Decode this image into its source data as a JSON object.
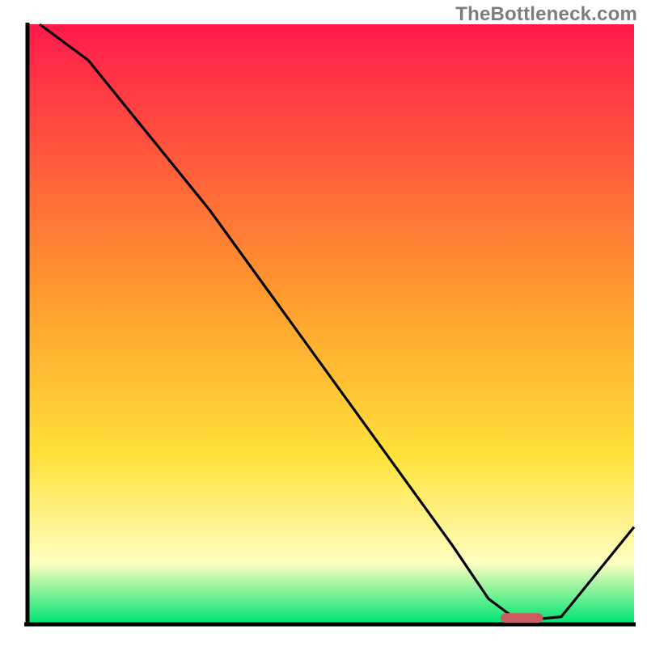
{
  "watermark": "TheBottleneck.com",
  "colors": {
    "gradient_top": "#ff1a4b",
    "gradient_mid1": "#ff9a2e",
    "gradient_mid2": "#ffe13a",
    "gradient_pale": "#ffffc0",
    "gradient_bottom": "#00e472",
    "axis": "#000000",
    "curve": "#000000",
    "marker_fill": "#cc5a60",
    "marker_stroke": "#b44a50"
  },
  "chart_data": {
    "type": "line",
    "title": "",
    "xlabel": "",
    "ylabel": "",
    "xlim": [
      0,
      100
    ],
    "ylim": [
      0,
      100
    ],
    "curve": {
      "x": [
        2,
        10,
        22,
        30,
        40,
        50,
        60,
        70,
        76,
        80,
        83,
        88,
        100
      ],
      "y": [
        100,
        94,
        79,
        69,
        55,
        41,
        27,
        13,
        4,
        1,
        0.5,
        1,
        16
      ]
    },
    "marker_segment": {
      "x0": 78,
      "x1": 85,
      "y": 0.8
    },
    "annotations": []
  }
}
